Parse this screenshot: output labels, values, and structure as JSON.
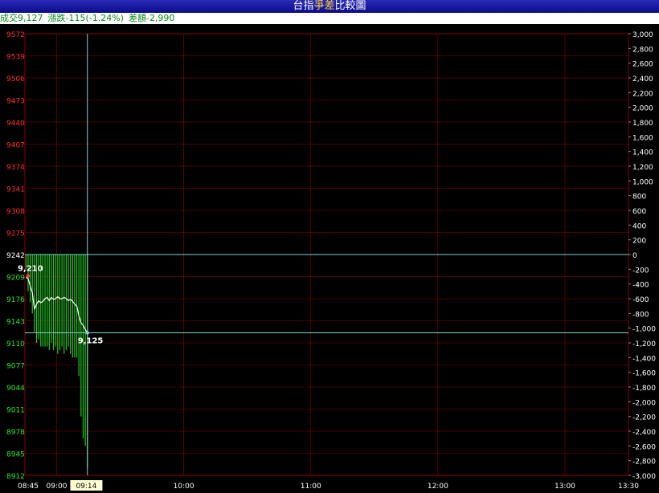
{
  "header": {
    "title_a": "台指",
    "title_b": "爭差",
    "title_c": "比較圖"
  },
  "info": {
    "volume": "成交9,127",
    "change": "漲跌-115(-1.24%)",
    "diff": "差額-2,990"
  },
  "chart_data": {
    "type": "line",
    "y_left_ticks": [
      "9572",
      "9539",
      "9506",
      "9473",
      "9440",
      "9407",
      "9374",
      "9341",
      "9308",
      "9275",
      "9242",
      "9209",
      "9176",
      "9143",
      "9110",
      "9077",
      "9044",
      "9011",
      "8978",
      "8945",
      "8912"
    ],
    "y_left_reference": "9242",
    "y_right_ticks": [
      "3,000",
      "2,800",
      "2,600",
      "2,400",
      "2,200",
      "2,000",
      "1,800",
      "1,600",
      "1,400",
      "1,200",
      "1,000",
      "800",
      "600",
      "400",
      "200",
      "0",
      "-200",
      "-400",
      "-600",
      "-800",
      "-1,000",
      "-1,200",
      "-1,400",
      "-1,600",
      "-1,800",
      "-2,000",
      "-2,200",
      "-2,400",
      "-2,600",
      "-2,800",
      "-3,000"
    ],
    "x_ticks": [
      "08:45",
      "09:00",
      "09:14",
      "10:00",
      "11:00",
      "12:00",
      "13:00",
      "13:30"
    ],
    "x_cursor_label": "09:14",
    "ylim_left": [
      8912,
      9572
    ],
    "ylim_right": [
      -3000,
      3000
    ],
    "xlim_minutes": [
      0,
      285
    ],
    "cursor_minute": 29,
    "series": [
      {
        "name": "price",
        "color": "#ffffff",
        "x": [
          0,
          1,
          2,
          3,
          4,
          5,
          6,
          7,
          8,
          9,
          10,
          11,
          12,
          13,
          14,
          15,
          16,
          17,
          18,
          19,
          20,
          21,
          22,
          23,
          24,
          25,
          26,
          27,
          28,
          29
        ],
        "y": [
          9208,
          9206,
          9195,
          9185,
          9160,
          9168,
          9173,
          9170,
          9172,
          9176,
          9178,
          9173,
          9178,
          9175,
          9176,
          9179,
          9176,
          9176,
          9178,
          9176,
          9173,
          9175,
          9172,
          9168,
          9165,
          9150,
          9140,
          9136,
          9130,
          9125
        ]
      },
      {
        "name": "spread",
        "color": "#22cc22",
        "x": [
          0,
          1,
          2,
          3,
          4,
          5,
          6,
          7,
          8,
          9,
          10,
          11,
          12,
          13,
          14,
          15,
          16,
          17,
          18,
          19,
          20,
          21,
          22,
          23,
          24,
          25,
          26,
          27,
          28,
          29
        ],
        "y": [
          -200,
          -500,
          -650,
          -800,
          -1050,
          -1200,
          -1150,
          -1250,
          -1250,
          -1250,
          -1250,
          -1300,
          -1200,
          -1300,
          -1250,
          -1350,
          -1300,
          -1250,
          -1350,
          -1300,
          -1250,
          -1350,
          -1400,
          -1400,
          -1400,
          -1650,
          -2200,
          -2500,
          -2600,
          -2900
        ]
      }
    ],
    "annotations": [
      {
        "text": "9,210",
        "x": 1,
        "y": 9210
      },
      {
        "text": "9,125",
        "x": 29,
        "y": 9125
      }
    ],
    "colors": {
      "grid": "#8b0000",
      "left_ticks_above": "#ff3030",
      "left_tick_ref": "#ffffff",
      "left_ticks_below": "#2ee82e",
      "right_ticks": "#ffffff",
      "x_ticks": "#ffffff",
      "crosshair": "#7fd4d4",
      "annotation_high": "#ff4040"
    }
  }
}
